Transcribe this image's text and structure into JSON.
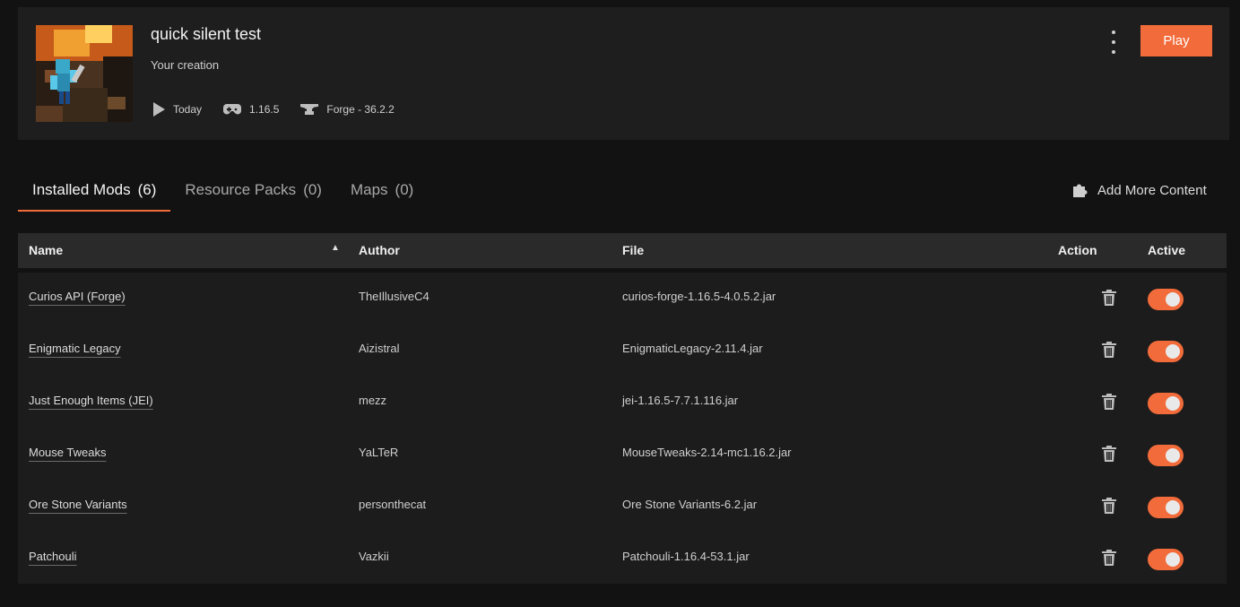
{
  "header": {
    "title": "quick silent test",
    "subtitle": "Your creation",
    "last_played": "Today",
    "game_version": "1.16.5",
    "loader": "Forge - 36.2.2",
    "play_label": "Play",
    "accent_color": "#f26b3a"
  },
  "tabs": [
    {
      "label": "Installed Mods",
      "count": "(6)",
      "active": true
    },
    {
      "label": "Resource Packs",
      "count": "(0)",
      "active": false
    },
    {
      "label": "Maps",
      "count": "(0)",
      "active": false
    }
  ],
  "add_content_label": "Add More Content",
  "table": {
    "headers": {
      "name": "Name",
      "author": "Author",
      "file": "File",
      "action": "Action",
      "active": "Active"
    },
    "sort": {
      "column": "name",
      "direction": "asc"
    },
    "rows": [
      {
        "name": "Curios API (Forge)",
        "author": "TheIllusiveC4",
        "file": "curios-forge-1.16.5-4.0.5.2.jar",
        "active": true
      },
      {
        "name": "Enigmatic Legacy",
        "author": "Aizistral",
        "file": "EnigmaticLegacy-2.11.4.jar",
        "active": true
      },
      {
        "name": "Just Enough Items (JEI)",
        "author": "mezz",
        "file": "jei-1.16.5-7.7.1.116.jar",
        "active": true
      },
      {
        "name": "Mouse Tweaks",
        "author": "YaLTeR",
        "file": "MouseTweaks-2.14-mc1.16.2.jar",
        "active": true
      },
      {
        "name": "Ore Stone Variants",
        "author": "personthecat",
        "file": "Ore Stone Variants-6.2.jar",
        "active": true
      },
      {
        "name": "Patchouli",
        "author": "Vazkii",
        "file": "Patchouli-1.16.4-53.1.jar",
        "active": true
      }
    ]
  },
  "icons": {
    "play": "play-icon",
    "version": "gamepad-icon",
    "loader": "anvil-icon",
    "menu": "kebab-menu-icon",
    "add": "puzzle-piece-icon",
    "delete": "trash-icon"
  }
}
